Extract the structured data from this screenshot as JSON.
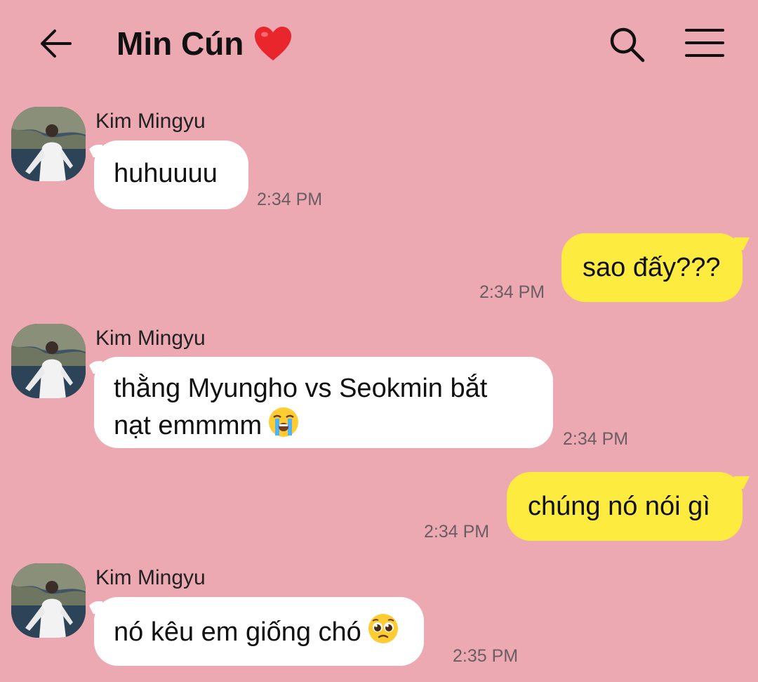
{
  "header": {
    "title": "Min Cún",
    "back_icon": "arrow-left-icon",
    "title_icon": "red-heart-icon",
    "search_icon": "search-icon",
    "menu_icon": "hamburger-menu-icon"
  },
  "colors": {
    "background": "#eca9b2",
    "incoming_bubble": "#ffffff",
    "outgoing_bubble": "#fdeb3f"
  },
  "messages": [
    {
      "direction": "incoming",
      "sender": "Kim Mingyu",
      "text": "huhuuuu",
      "time": "2:34 PM"
    },
    {
      "direction": "outgoing",
      "text": "sao đấy???",
      "time": "2:34 PM"
    },
    {
      "direction": "incoming",
      "sender": "Kim Mingyu",
      "text_line1": "thằng Myungho vs Seokmin bắt",
      "text_line2": "nạt emmmm",
      "emoji": "loudly-crying-face-icon",
      "time": "2:34 PM"
    },
    {
      "direction": "outgoing",
      "text": "chúng nó nói gì",
      "time": "2:34 PM"
    },
    {
      "direction": "incoming",
      "sender": "Kim Mingyu",
      "text": "nó kêu em giống chó",
      "emoji": "pleading-face-icon",
      "time": "2:35 PM"
    }
  ]
}
